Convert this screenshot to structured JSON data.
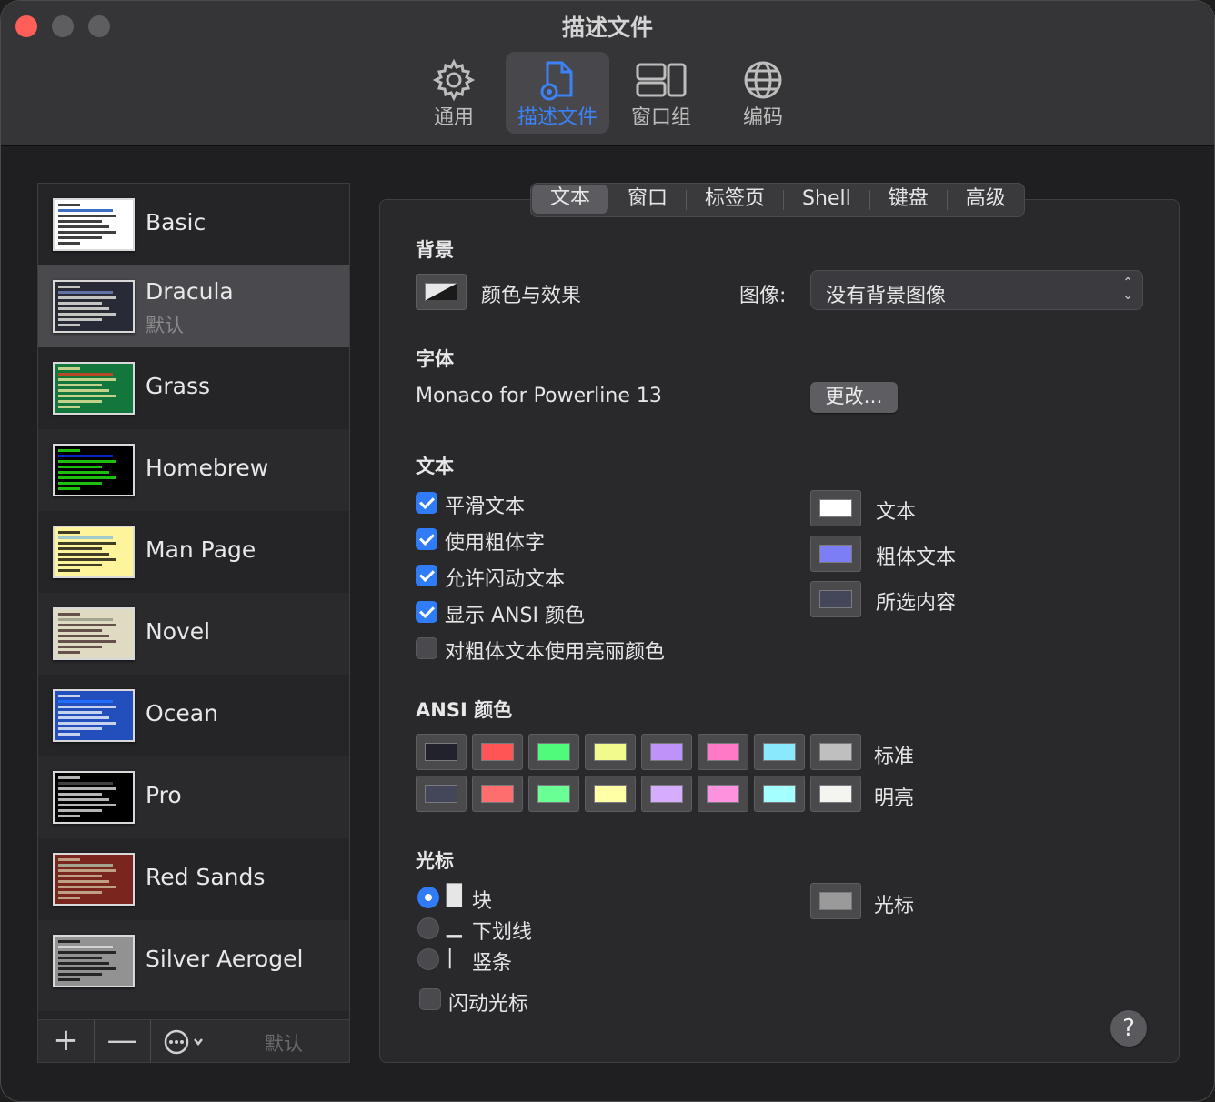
{
  "window": {
    "title": "描述文件"
  },
  "toolbar": {
    "items": [
      {
        "label": "通用",
        "icon": "gear-icon"
      },
      {
        "label": "描述文件",
        "icon": "profile-doc-icon",
        "active": true
      },
      {
        "label": "窗口组",
        "icon": "window-groups-icon"
      },
      {
        "label": "编码",
        "icon": "globe-icon"
      }
    ]
  },
  "sidebar": {
    "profiles": [
      {
        "name": "Basic",
        "sub": "",
        "bg": "#ffffff",
        "fg": "#000000",
        "hl": "#3c6fc4"
      },
      {
        "name": "Dracula",
        "sub": "默认",
        "bg": "#282a36",
        "fg": "#f8f8f2",
        "hl": "#6272a4"
      },
      {
        "name": "Grass",
        "sub": "",
        "bg": "#13773d",
        "fg": "#fff0a5",
        "hl": "#b64926"
      },
      {
        "name": "Homebrew",
        "sub": "",
        "bg": "#000000",
        "fg": "#28fe14",
        "hl": "#0a23c4"
      },
      {
        "name": "Man Page",
        "sub": "",
        "bg": "#fef49c",
        "fg": "#000000",
        "hl": "#a4c9cd"
      },
      {
        "name": "Novel",
        "sub": "",
        "bg": "#dfdbc3",
        "fg": "#3b2322",
        "hl": "#a4a390"
      },
      {
        "name": "Ocean",
        "sub": "",
        "bg": "#224fbc",
        "fg": "#ffffff",
        "hl": "#216dff"
      },
      {
        "name": "Pro",
        "sub": "",
        "bg": "#000000",
        "fg": "#f2f2f2",
        "hl": "#414141"
      },
      {
        "name": "Red Sands",
        "sub": "",
        "bg": "#7a251e",
        "fg": "#d7c9a7",
        "hl": "#a4a390"
      },
      {
        "name": "Silver Aerogel",
        "sub": "",
        "bg": "#929292",
        "fg": "#000000",
        "hl": "#d2d2d2"
      }
    ],
    "buttons": {
      "add": "+",
      "remove": "—",
      "default": "默认"
    }
  },
  "tabs": [
    "文本",
    "窗口",
    "标签页",
    "Shell",
    "键盘",
    "高级"
  ],
  "background": {
    "title": "背景",
    "color_effects_label": "颜色与效果",
    "image_label": "图像:",
    "image_value": "没有背景图像"
  },
  "font": {
    "title": "字体",
    "value": "Monaco for Powerline 13",
    "change_button": "更改…"
  },
  "text": {
    "title": "文本",
    "options": [
      {
        "label": "平滑文本",
        "checked": true
      },
      {
        "label": "使用粗体字",
        "checked": true
      },
      {
        "label": "允许闪动文本",
        "checked": true
      },
      {
        "label": "显示 ANSI 颜色",
        "checked": true
      },
      {
        "label": "对粗体文本使用亮丽颜色",
        "checked": false
      }
    ],
    "colors": [
      {
        "label": "文本",
        "color": "#ffffff"
      },
      {
        "label": "粗体文本",
        "color": "#7b7ef5"
      },
      {
        "label": "所选内容",
        "color": "#44475a"
      }
    ]
  },
  "ansi": {
    "title": "ANSI 颜色",
    "standard_label": "标准",
    "bright_label": "明亮",
    "standard": [
      "#21222c",
      "#ff5555",
      "#50fa7b",
      "#f1fa8c",
      "#bd93f9",
      "#ff79c6",
      "#8be9fd",
      "#bfbfbf"
    ],
    "bright": [
      "#44475a",
      "#ff6e6e",
      "#69ff94",
      "#ffffa5",
      "#d6acff",
      "#ff92df",
      "#a4ffff",
      "#f4f4f0"
    ]
  },
  "cursor": {
    "title": "光标",
    "shapes": [
      {
        "glyph": "█",
        "label": "块",
        "selected": true
      },
      {
        "glyph": "▁",
        "label": "下划线",
        "selected": false
      },
      {
        "glyph": "|",
        "label": "竖条",
        "selected": false
      }
    ],
    "blink_label": "闪动光标",
    "blink_checked": false,
    "color_label": "光标",
    "color": "#9a9a9a"
  },
  "help": "?"
}
